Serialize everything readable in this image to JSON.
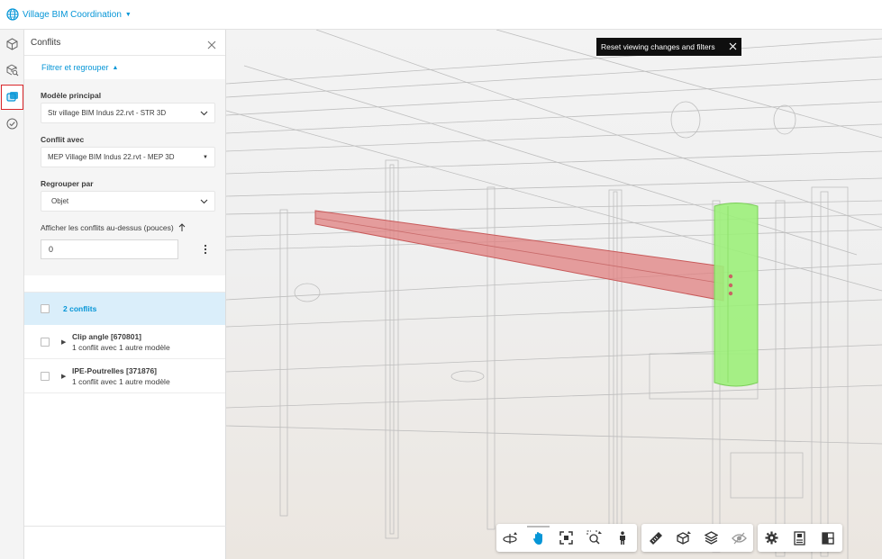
{
  "header": {
    "project_name": "Village BIM Coordination"
  },
  "panel": {
    "title": "Conflits",
    "filter_toggle": "Filtrer et regrouper",
    "main_model_label": "Modèle principal",
    "main_model_value": "Str village BIM Indus 22.rvt - STR 3D",
    "clash_with_label": "Conflit avec",
    "clash_with_value": "MEP Village BIM Indus 22.rvt - MEP 3D",
    "group_by_label": "Regrouper par",
    "group_by_value": "Objet",
    "threshold_label": "Afficher les conflits au-dessus (pouces)",
    "threshold_value": "0",
    "summary": "2 conflits",
    "items": [
      {
        "name": "Clip angle [670801]",
        "detail": "1 conflit avec 1 autre modèle"
      },
      {
        "name": "IPE-Poutrelles [371876]",
        "detail": "1 conflit avec 1 autre modèle"
      }
    ]
  },
  "viewer": {
    "toast": "Reset viewing changes and filters",
    "toolbar_icons": [
      "orbit-icon",
      "pan-icon",
      "fit-view-icon",
      "zoom-icon",
      "first-person-icon",
      "measure-icon",
      "section-icon",
      "model-browser-icon",
      "visibility-icon",
      "settings-icon",
      "properties-icon",
      "fullscreen-icon"
    ]
  },
  "colors": {
    "accent": "#0696d7",
    "clash_red": "#e07c7c",
    "clash_green": "#9cf07a",
    "active_rail": "#d9262a"
  }
}
